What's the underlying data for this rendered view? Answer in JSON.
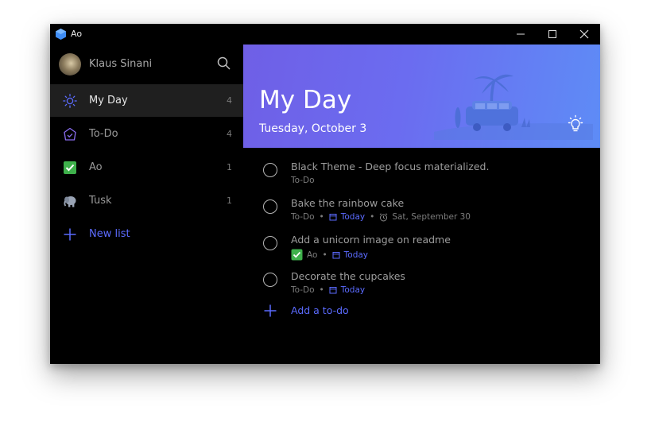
{
  "window": {
    "title": "Ao"
  },
  "user": {
    "name": "Klaus Sinani"
  },
  "sidebar": {
    "items": [
      {
        "label": "My Day",
        "count": "4",
        "icon": "sun-icon"
      },
      {
        "label": "To-Do",
        "count": "4",
        "icon": "home-check-icon"
      },
      {
        "label": "Ao",
        "count": "1",
        "icon": "green-check-icon"
      },
      {
        "label": "Tusk",
        "count": "1",
        "icon": "elephant-icon"
      }
    ],
    "new_list_label": "New list"
  },
  "main": {
    "title": "My Day",
    "date": "Tuesday, October 3",
    "tasks": [
      {
        "title": "Black Theme - Deep focus materialized.",
        "list": "To-Do"
      },
      {
        "title": "Bake the rainbow cake",
        "list": "To-Do",
        "due": "Today",
        "reminder": "Sat, September 30"
      },
      {
        "title": "Add a unicorn image on readme",
        "list": "Ao",
        "due": "Today"
      },
      {
        "title": "Decorate the cupcakes",
        "list": "To-Do",
        "due": "Today"
      }
    ],
    "add_label": "Add a to-do"
  },
  "colors": {
    "accent": "#5b6bff",
    "banner_start": "#6f5fe6",
    "banner_end": "#5e8cf6",
    "ao_green": "#3eb04b"
  }
}
